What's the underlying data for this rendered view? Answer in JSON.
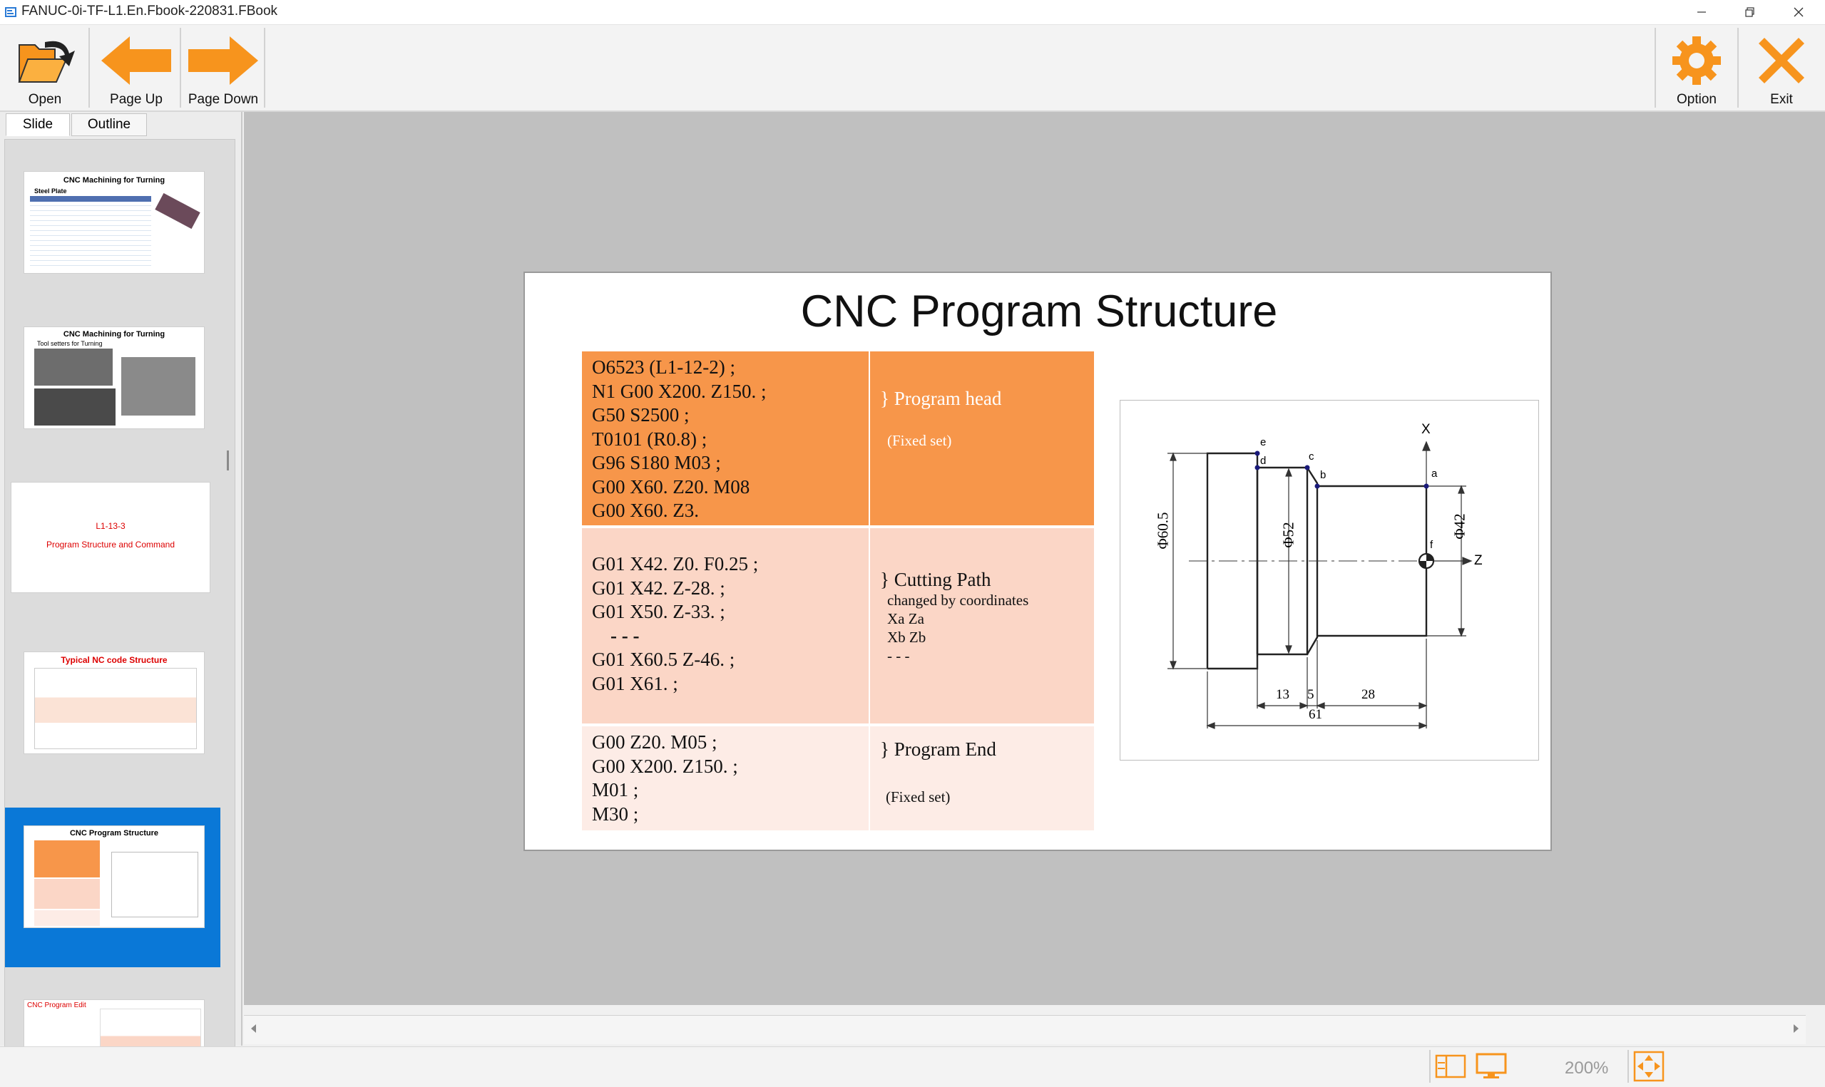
{
  "window": {
    "title": "FANUC-0i-TF-L1.En.Fbook-220831.FBook",
    "controls": [
      "minimize",
      "maximize",
      "close"
    ]
  },
  "toolbar": {
    "open_label": "Open",
    "page_up_label": "Page Up",
    "page_down_label": "Page Down",
    "option_label": "Option",
    "exit_label": "Exit",
    "accent_color": "#f7941d"
  },
  "left_panel": {
    "tabs": [
      {
        "label": "Slide",
        "active": true
      },
      {
        "label": "Outline",
        "active": false
      }
    ],
    "thumbnails": [
      {
        "title": "CNC Machining for Turning",
        "subtitle": "Steel Plate",
        "selected": false
      },
      {
        "title": "CNC Machining for Turning",
        "subtitle": "Tool setters for Turning",
        "selected": false
      },
      {
        "title": "L1-13-3",
        "subtitle": "Program Structure and Command",
        "selected": false
      },
      {
        "title": "Typical NC code Structure",
        "subtitle": "",
        "selected": false
      },
      {
        "title": "CNC Program Structure",
        "subtitle": "",
        "selected": true
      },
      {
        "title": "CNC Program Edit",
        "subtitle": "",
        "selected": false
      }
    ]
  },
  "slide": {
    "title": "CNC Program Structure",
    "rows": [
      {
        "code": [
          "O6523 (L1-12-2) ;",
          "N1 G00 X200. Z150. ;",
          "G50 S2500 ;",
          "T0101 (R0.8) ;",
          "G96 S180 M03 ;",
          "G00 X60. Z20. M08",
          "G00 X60. Z3."
        ],
        "label": "} Program head",
        "note": "(Fixed set)",
        "code_bg": "#f7964a",
        "label_bg": "#f7964a"
      },
      {
        "code": [
          "G01 X42. Z0. F0.25 ;",
          "G01 X42. Z-28. ;",
          "G01 X50. Z-33. ;",
          "- - -",
          "G01 X60.5 Z-46. ;",
          "G01 X61. ;"
        ],
        "label": "} Cutting Path",
        "note_lines": [
          "changed by coordinates",
          "Xa  Za",
          "Xb  Zb",
          "- - -"
        ],
        "code_bg": "#fbd6c6",
        "label_bg": "#fbd6c6"
      },
      {
        "code": [
          "G00 Z20. M05 ;",
          "G00 X200. Z150. ;",
          "M01 ;",
          "M30 ;"
        ],
        "label": "} Program End",
        "note": "(Fixed set)",
        "code_bg": "#fdece6",
        "label_bg": "#fdece6"
      }
    ],
    "drawing": {
      "dim_d605": "Φ60.5",
      "dim_d52": "Φ52",
      "dim_d42": "Φ42",
      "dim_13": "13",
      "dim_5": "5",
      "dim_28": "28",
      "dim_61": "61",
      "axis_x": "X",
      "axis_z": "Z",
      "points": [
        "a",
        "b",
        "c",
        "d",
        "e",
        "f"
      ]
    }
  },
  "status": {
    "zoom": "200%"
  }
}
